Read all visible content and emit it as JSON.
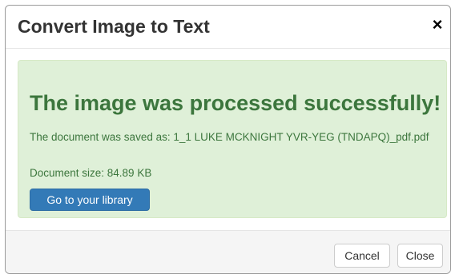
{
  "dialog": {
    "title": "Convert Image to Text",
    "close_glyph": "×"
  },
  "alert": {
    "heading": "The image was processed successfully!",
    "saved_line": "The document was saved as: 1_1 LUKE MCKNIGHT YVR-YEG (TNDAPQ)_pdf.pdf",
    "size_line": "Document size: 84.89 KB",
    "library_button": "Go to your library",
    "colors": {
      "background": "#dff0d8",
      "text": "#3c763d",
      "button": "#337ab7"
    }
  },
  "footer": {
    "cancel_label": "Cancel",
    "close_label": "Close"
  }
}
